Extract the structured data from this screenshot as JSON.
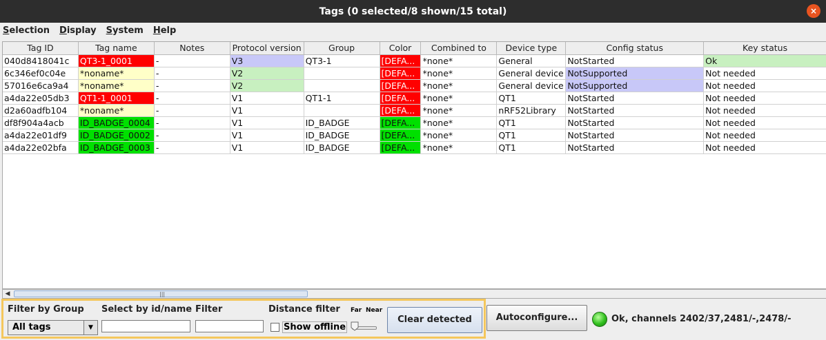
{
  "window": {
    "title": "Tags (0 selected/8 shown/15 total)",
    "close_glyph": "×"
  },
  "menu": [
    "Selection",
    "Display",
    "System",
    "Help"
  ],
  "table": {
    "columns": [
      "Tag ID",
      "Tag name",
      "Notes",
      "Protocol version",
      "Group",
      "Color",
      "Combined to",
      "Device type",
      "Config status",
      "Key status"
    ],
    "rows": [
      {
        "cells": [
          "040d8418041c",
          "QT3-1_0001",
          "-",
          "V3",
          "QT3-1",
          "[DEFA...",
          "*none*",
          "General",
          "NotStarted",
          "Ok"
        ],
        "colors": [
          "",
          "#ff0000",
          "",
          "#c8c8f8",
          "",
          "#ff0000",
          "",
          "",
          "",
          "#c8f0c0"
        ]
      },
      {
        "cells": [
          "6c346ef0c04e",
          "*noname*",
          "-",
          "V2",
          "",
          "[DEFA...",
          "*none*",
          "General device",
          "NotSupported",
          "Not needed"
        ],
        "colors": [
          "",
          "#ffffc8",
          "",
          "#c8f0c0",
          "",
          "#ff0000",
          "",
          "",
          "#c8c8f8",
          ""
        ]
      },
      {
        "cells": [
          "57016e6ca9a4",
          "*noname*",
          "-",
          "V2",
          "",
          "[DEFA...",
          "*none*",
          "General device",
          "NotSupported",
          "Not needed"
        ],
        "colors": [
          "",
          "#ffffc8",
          "",
          "#c8f0c0",
          "",
          "#ff0000",
          "",
          "",
          "#c8c8f8",
          ""
        ]
      },
      {
        "cells": [
          "a4da22e05db3",
          "QT1-1_0001",
          "-",
          "V1",
          "QT1-1",
          "[DEFA...",
          "*none*",
          "QT1",
          "NotStarted",
          "Not needed"
        ],
        "colors": [
          "",
          "#ff0000",
          "",
          "",
          "",
          "#ff0000",
          "",
          "",
          "",
          ""
        ]
      },
      {
        "cells": [
          "d2a60adfb104",
          "*noname*",
          "-",
          "V1",
          "",
          "[DEFA...",
          "*none*",
          "nRF52Library",
          "NotStarted",
          "Not needed"
        ],
        "colors": [
          "",
          "#ffffc8",
          "",
          "",
          "",
          "#ff0000",
          "",
          "",
          "",
          ""
        ]
      },
      {
        "cells": [
          "df8f904a4acb",
          "ID_BADGE_0004",
          "-",
          "V1",
          "ID_BADGE",
          "[DEFA...",
          "*none*",
          "QT1",
          "NotStarted",
          "Not needed"
        ],
        "colors": [
          "",
          "#00e000",
          "",
          "",
          "",
          "#00e000",
          "",
          "",
          "",
          ""
        ]
      },
      {
        "cells": [
          "a4da22e01df9",
          "ID_BADGE_0002",
          "-",
          "V1",
          "ID_BADGE",
          "[DEFA...",
          "*none*",
          "QT1",
          "NotStarted",
          "Not needed"
        ],
        "colors": [
          "",
          "#00e000",
          "",
          "",
          "",
          "#00e000",
          "",
          "",
          "",
          ""
        ]
      },
      {
        "cells": [
          "a4da22e02bfa",
          "ID_BADGE_0003",
          "-",
          "V1",
          "ID_BADGE",
          "[DEFA...",
          "*none*",
          "QT1",
          "NotStarted",
          "Not needed"
        ],
        "colors": [
          "",
          "#00e000",
          "",
          "",
          "",
          "#00e000",
          "",
          "",
          "",
          ""
        ]
      }
    ]
  },
  "controls": {
    "filter_by_group_label": "Filter by Group",
    "filter_by_group_value": "All tags",
    "select_by_label": "Select by id/name",
    "select_by_value": "",
    "filter_label": "Filter",
    "filter_value": "",
    "distance_filter_label": "Distance filter",
    "show_offline_label": "Show offline",
    "show_offline_checked": false,
    "far_label": "Far",
    "near_label": "Near",
    "clear_detected_label": "Clear detected",
    "autoconfigure_label": "Autoconfigure...",
    "status_text": "Ok, channels 2402/37,2481/-,2478/-",
    "status_color": "#31c01e",
    "highlight_color": "#f4c75c"
  }
}
